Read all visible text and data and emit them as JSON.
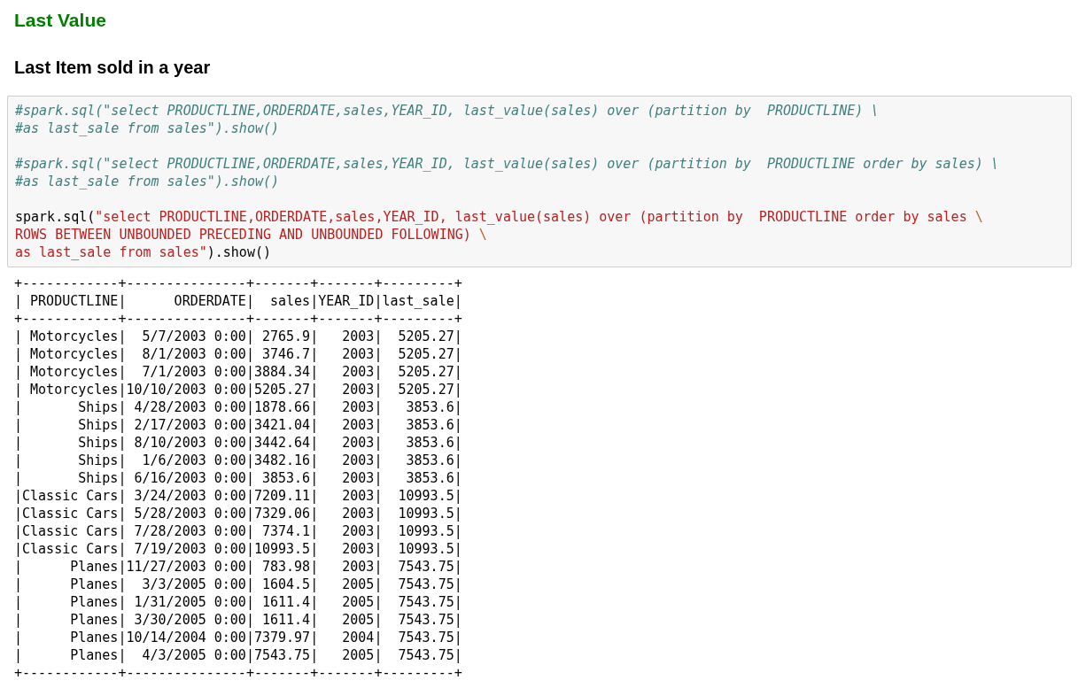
{
  "headings": [
    {
      "kind": "title",
      "text": "Last Value"
    },
    {
      "kind": "subtitle",
      "text": "Last Item sold in a year"
    }
  ],
  "code_cell": {
    "blocks": [
      [
        [
          {
            "kind": "comment",
            "text": "#spark.sql(\"select PRODUCTLINE,ORDERDATE,sales,YEAR_ID, last_value(sales) over (partition by  PRODUCTLINE) \\"
          }
        ],
        [
          {
            "kind": "comment",
            "text": "#as last_sale from sales\").show()"
          }
        ]
      ],
      [
        [
          {
            "kind": "comment",
            "text": "#spark.sql(\"select PRODUCTLINE,ORDERDATE,sales,YEAR_ID, last_value(sales) over (partition by  PRODUCTLINE order by sales) \\"
          }
        ],
        [
          {
            "kind": "comment",
            "text": "#as last_sale from sales\").show()"
          }
        ]
      ],
      [
        [
          {
            "kind": "plain",
            "text": "spark.sql("
          },
          {
            "kind": "string",
            "text": "\"select PRODUCTLINE,ORDERDATE,sales,YEAR_ID, last_value(sales) over (partition by  PRODUCTLINE order by sales "
          },
          {
            "kind": "escape",
            "text": "\\"
          }
        ],
        [
          {
            "kind": "string",
            "text": "ROWS BETWEEN UNBOUNDED PRECEDING AND UNBOUNDED FOLLOWING) "
          },
          {
            "kind": "escape",
            "text": "\\"
          }
        ],
        [
          {
            "kind": "string",
            "text": "as last_sale from sales\""
          },
          {
            "kind": "plain",
            "text": ").show()"
          }
        ]
      ]
    ]
  },
  "output_lines": [
    "+------------+---------------+-------+-------+---------+",
    "| PRODUCTLINE|      ORDERDATE|  sales|YEAR_ID|last_sale|",
    "+------------+---------------+-------+-------+---------+",
    "| Motorcycles|  5/7/2003 0:00| 2765.9|   2003|  5205.27|",
    "| Motorcycles|  8/1/2003 0:00| 3746.7|   2003|  5205.27|",
    "| Motorcycles|  7/1/2003 0:00|3884.34|   2003|  5205.27|",
    "| Motorcycles|10/10/2003 0:00|5205.27|   2003|  5205.27|",
    "|       Ships| 4/28/2003 0:00|1878.66|   2003|   3853.6|",
    "|       Ships| 2/17/2003 0:00|3421.04|   2003|   3853.6|",
    "|       Ships| 8/10/2003 0:00|3442.64|   2003|   3853.6|",
    "|       Ships|  1/6/2003 0:00|3482.16|   2003|   3853.6|",
    "|       Ships| 6/16/2003 0:00| 3853.6|   2003|   3853.6|",
    "|Classic Cars| 3/24/2003 0:00|7209.11|   2003|  10993.5|",
    "|Classic Cars| 5/28/2003 0:00|7329.06|   2003|  10993.5|",
    "|Classic Cars| 7/28/2003 0:00| 7374.1|   2003|  10993.5|",
    "|Classic Cars| 7/19/2003 0:00|10993.5|   2003|  10993.5|",
    "|      Planes|11/27/2003 0:00| 783.98|   2003|  7543.75|",
    "|      Planes|  3/3/2005 0:00| 1604.5|   2005|  7543.75|",
    "|      Planes| 1/31/2005 0:00| 1611.4|   2005|  7543.75|",
    "|      Planes| 3/30/2005 0:00| 1611.4|   2005|  7543.75|",
    "|      Planes|10/14/2004 0:00|7379.97|   2004|  7543.75|",
    "|      Planes|  4/3/2005 0:00|7543.75|   2005|  7543.75|",
    "+------------+---------------+-------+-------+---------+"
  ]
}
